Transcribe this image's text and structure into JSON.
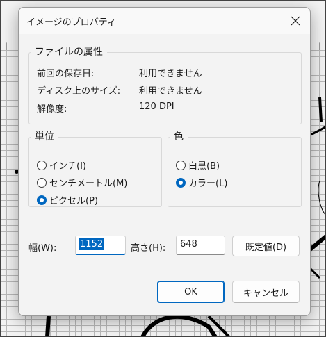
{
  "dialog": {
    "title": "イメージのプロパティ",
    "file_attributes": {
      "legend": "ファイルの属性",
      "rows": [
        {
          "label": "前回の保存日:",
          "value": "利用できません"
        },
        {
          "label": "ディスク上のサイズ:",
          "value": "利用できません"
        },
        {
          "label": "解像度:",
          "value": "120 DPI"
        }
      ]
    },
    "units": {
      "legend": "単位",
      "options": [
        {
          "label": "インチ(I)",
          "checked": false
        },
        {
          "label": "センチメートル(M)",
          "checked": false
        },
        {
          "label": "ピクセル(P)",
          "checked": true
        }
      ]
    },
    "color": {
      "legend": "色",
      "options": [
        {
          "label": "白黒(B)",
          "checked": false
        },
        {
          "label": "カラー(L)",
          "checked": true
        }
      ]
    },
    "width": {
      "label": "幅(W):",
      "value": "1152"
    },
    "height": {
      "label": "高さ(H):",
      "value": "648"
    },
    "buttons": {
      "default_label": "既定値(D)",
      "ok_label": "OK",
      "cancel_label": "キャンセル"
    }
  },
  "colors": {
    "accent": "#0067c0",
    "dialog_bg": "#f3f3f3",
    "grid": "#b9b9b9"
  }
}
